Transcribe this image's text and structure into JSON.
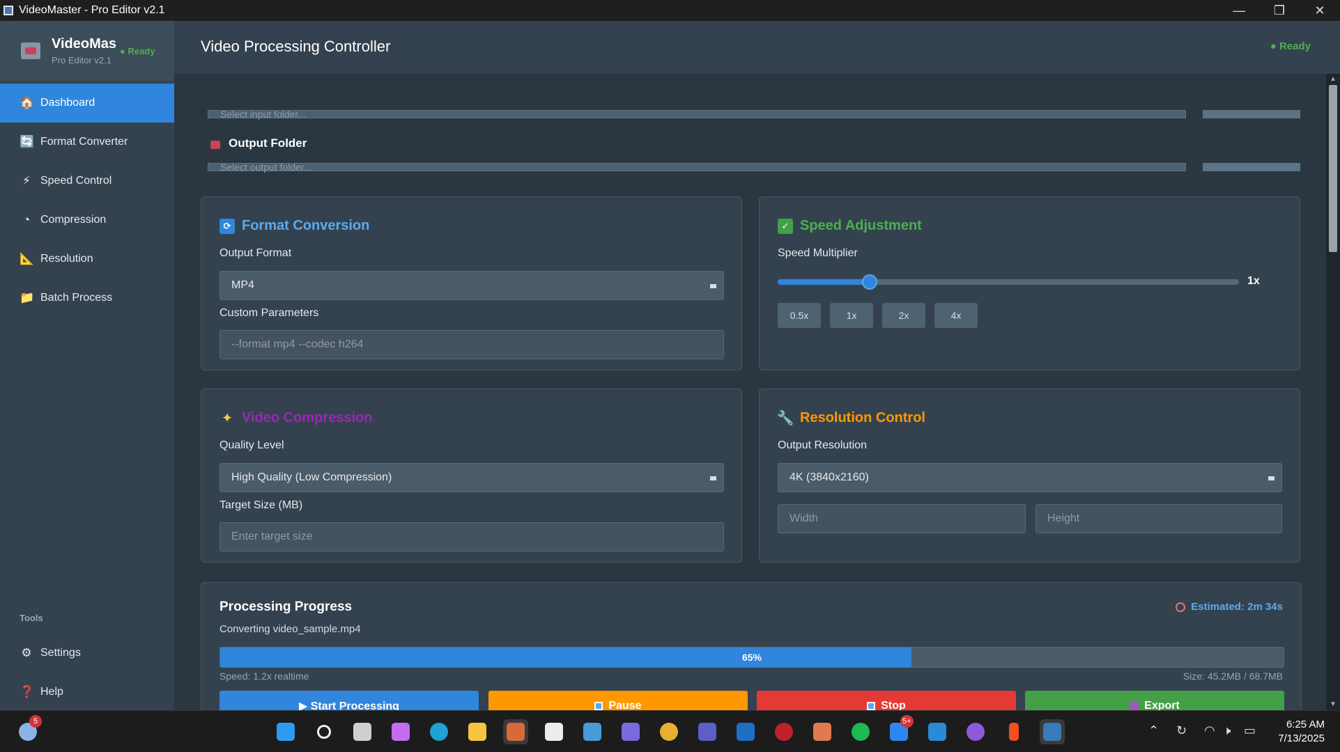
{
  "window": {
    "title": "VideoMaster - Pro Editor v2.1",
    "minimize": "—",
    "restore": "❐",
    "close": "✕"
  },
  "sidebar": {
    "app_name": "VideoMas",
    "app_subtitle": "Pro Editor v2.1",
    "status": "● Ready",
    "items": [
      {
        "label": "Dashboard",
        "icon": "home-icon",
        "glyph": "🏠",
        "active": true
      },
      {
        "label": "Format Converter",
        "icon": "refresh-icon",
        "glyph": "🔄"
      },
      {
        "label": "Speed Control",
        "icon": "lightning-icon",
        "glyph": "⚡"
      },
      {
        "label": "Compression",
        "icon": "compress-icon",
        "glyph": "◔"
      },
      {
        "label": "Resolution",
        "icon": "ruler-icon",
        "glyph": "📐"
      },
      {
        "label": "Batch Process",
        "icon": "folder-icon",
        "glyph": "📁"
      }
    ],
    "tools_label": "Tools",
    "tools": [
      {
        "label": "Settings",
        "icon": "gear-icon",
        "glyph": "⚙"
      },
      {
        "label": "Help",
        "icon": "question-icon",
        "glyph": "❓"
      }
    ]
  },
  "header": {
    "title": "Video Processing Controller",
    "status": "● Ready"
  },
  "folders": {
    "input_placeholder": "Select input folder...",
    "output_label": "Output Folder",
    "output_placeholder": "Select output folder..."
  },
  "format": {
    "title": "Format Conversion",
    "output_format_label": "Output Format",
    "output_format_value": "MP4",
    "custom_params_label": "Custom Parameters",
    "custom_params_placeholder": "--format mp4 --codec h264"
  },
  "speed": {
    "title": "Speed Adjustment",
    "multiplier_label": "Speed Multiplier",
    "value_label": "1x",
    "slider_fraction": 0.2,
    "presets": [
      "0.5x",
      "1x",
      "2x",
      "4x"
    ]
  },
  "compression": {
    "title": "Video Compression",
    "quality_label": "Quality Level",
    "quality_value": "High Quality (Low Compression)",
    "target_label": "Target Size (MB)",
    "target_placeholder": "Enter target size"
  },
  "resolution": {
    "title": "Resolution Control",
    "output_label": "Output Resolution",
    "output_value": "4K (3840x2160)",
    "width_placeholder": "Width",
    "height_placeholder": "Height"
  },
  "progress": {
    "title": "Processing Progress",
    "estimate": "Estimated: 2m 34s",
    "current_file": "Converting video_sample.mp4",
    "percent": 65,
    "percent_label": "65%",
    "speed": "Speed: 1.2x realtime",
    "size": "Size: 45.2MB / 68.7MB",
    "buttons": {
      "start": "▶ Start Processing",
      "pause": "Pause",
      "stop": "Stop",
      "export": "Export"
    }
  },
  "taskbar": {
    "weather_badge": "5",
    "zalo_badge": "5+",
    "time": "6:25 AM",
    "date": "7/13/2025"
  },
  "colors": {
    "accent": "#2f86dc",
    "format_title": "#5aaaf0",
    "speed_title": "#4caf50",
    "compression_title": "#9c27b0",
    "resolution_title": "#ff9800",
    "pause": "#ff9800",
    "stop": "#e53935",
    "export": "#43a047"
  }
}
